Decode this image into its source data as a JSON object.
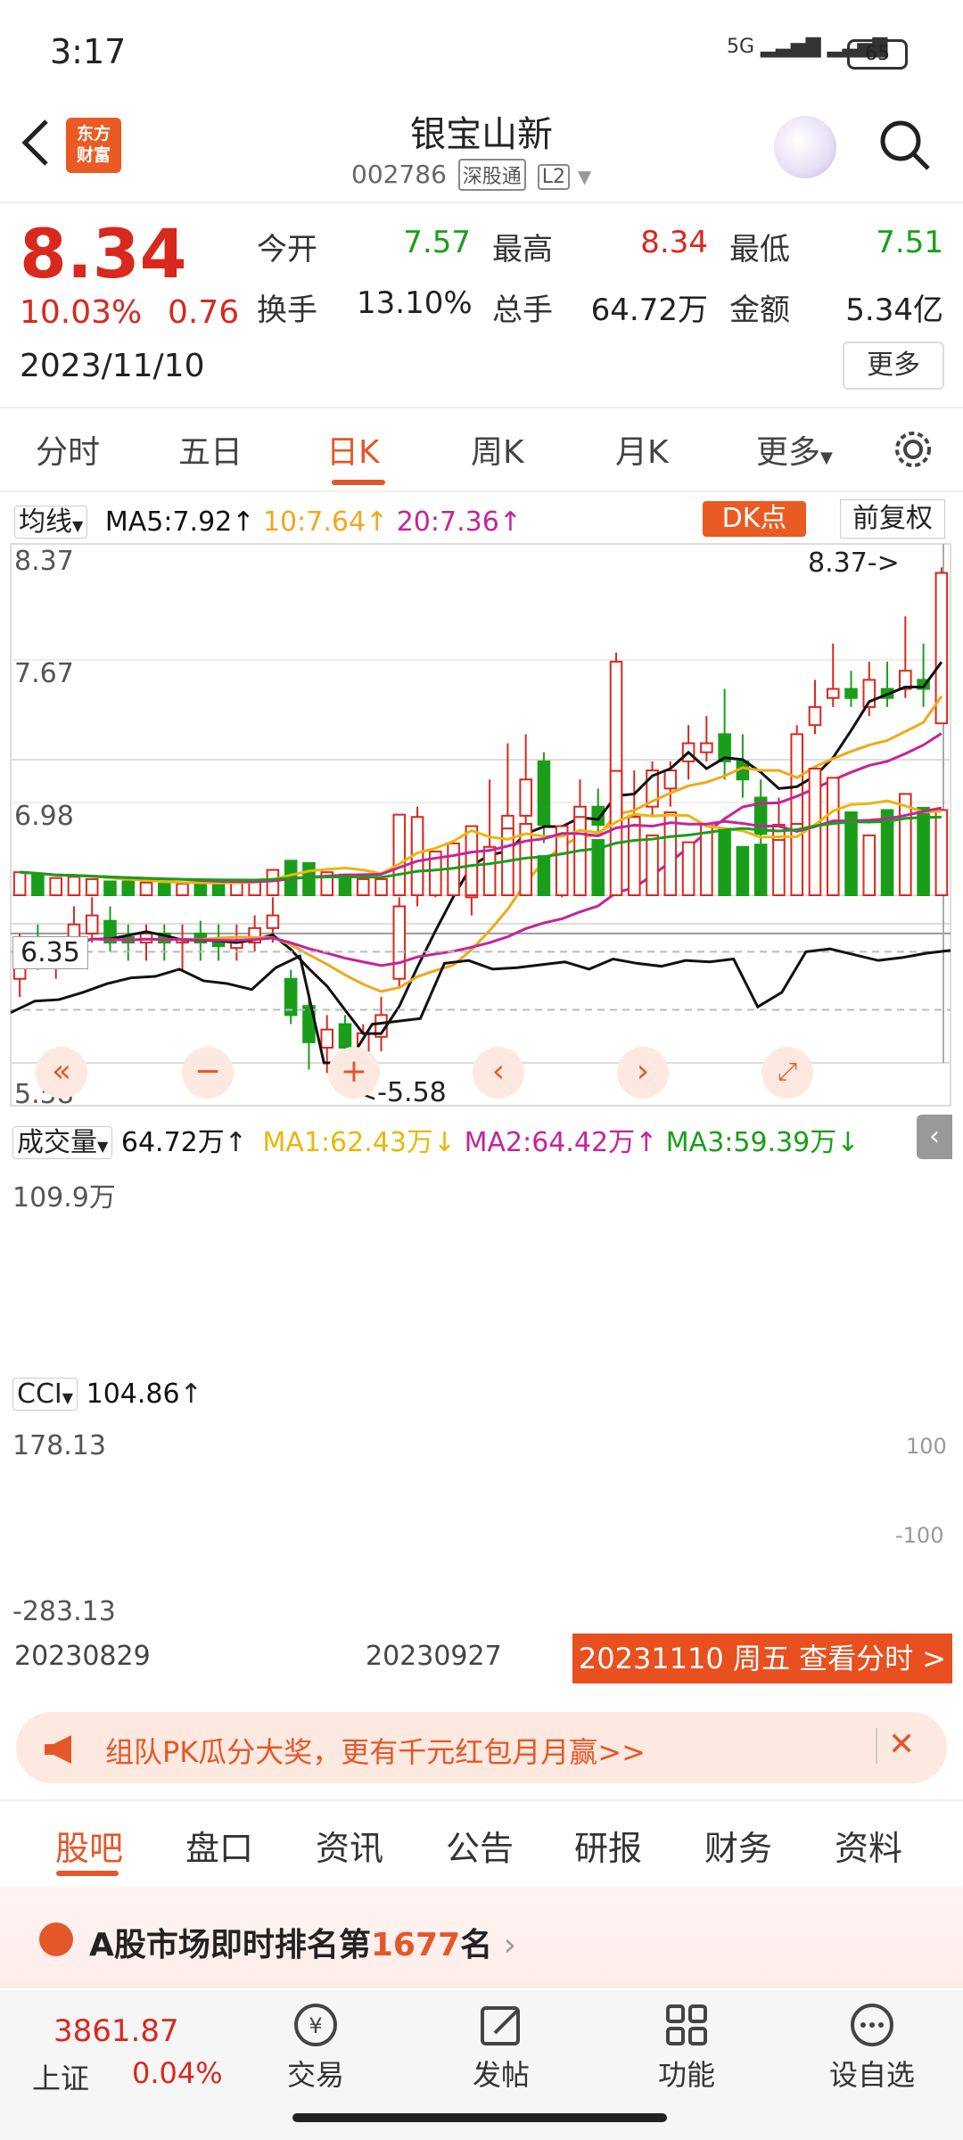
{
  "status_bar": {
    "time": "3:17",
    "signal": "5G",
    "battery": "65"
  },
  "header": {
    "logo_line1": "东方",
    "logo_line2": "财富",
    "stock_name": "银宝山新",
    "stock_code": "002786",
    "tag1": "深股通",
    "tag2": "L2"
  },
  "quote": {
    "price": "8.34",
    "change_pct": "10.03%",
    "change": "0.76",
    "date": "2023/11/10",
    "open_label": "今开",
    "open": "7.57",
    "high_label": "最高",
    "high": "8.34",
    "low_label": "最低",
    "low": "7.51",
    "turnover_label": "换手",
    "turnover": "13.10%",
    "volume_label": "总手",
    "volume": "64.72万",
    "amount_label": "金额",
    "amount": "5.34亿",
    "more": "更多"
  },
  "tabs": [
    "分时",
    "五日",
    "日K",
    "周K",
    "月K",
    "更多"
  ],
  "ma_bar": {
    "selector": "均线",
    "ma5": "MA5:7.92",
    "ma10": "10:7.64",
    "ma20": "20:7.36",
    "dk": "DK点",
    "fq": "前复权"
  },
  "price_axis": [
    "8.37",
    "7.67",
    "6.98",
    "6.35",
    "5.58"
  ],
  "annotations": {
    "high_marker": "8.37->",
    "low_marker": "<-5.58"
  },
  "volume_bar": {
    "selector": "成交量",
    "value": "64.72万",
    "ma1": "MA1:62.43万",
    "ma2": "MA2:64.42万",
    "ma3": "MA3:59.39万",
    "axis_max": "109.9万"
  },
  "cci_bar": {
    "selector": "CCI",
    "value": "104.86",
    "axis_top": "178.13",
    "axis_bottom": "-283.13",
    "level_top": "100",
    "level_bottom": "-100"
  },
  "date_axis": {
    "d1": "20230829",
    "d2": "20230927",
    "current": "20231110 周五 查看分时 >"
  },
  "banner": {
    "text": "组队PK瓜分大奖，更有千元红包月月赢>>"
  },
  "bottom_tabs": [
    "股吧",
    "盘口",
    "资讯",
    "公告",
    "研报",
    "财务",
    "资料"
  ],
  "rank": {
    "prefix": "A股市场即时排名第",
    "number": "1677",
    "suffix": "名"
  },
  "bottom_nav": {
    "index_value": "3861.87",
    "index_name": "上证",
    "index_pct": "0.04%",
    "items": [
      "交易",
      "发帖",
      "功能",
      "设自选"
    ]
  },
  "colors": {
    "up": "#d9281e",
    "down": "#1a9e1a",
    "accent": "#e4572a",
    "ma5": "#111111",
    "ma10": "#f0a81b",
    "ma20": "#c4249a"
  },
  "chart_data": {
    "type": "candlestick",
    "ylim": [
      5.4,
      8.5
    ],
    "candles": [
      [
        6.1,
        6.3,
        6.35,
        6.0
      ],
      [
        6.28,
        6.2,
        6.4,
        6.15
      ],
      [
        6.2,
        6.25,
        6.3,
        6.1
      ],
      [
        6.25,
        6.4,
        6.5,
        6.2
      ],
      [
        6.35,
        6.45,
        6.55,
        6.3
      ],
      [
        6.42,
        6.3,
        6.5,
        6.25
      ],
      [
        6.33,
        6.3,
        6.4,
        6.2
      ],
      [
        6.3,
        6.35,
        6.4,
        6.2
      ],
      [
        6.35,
        6.3,
        6.4,
        6.2
      ],
      [
        6.3,
        6.32,
        6.4,
        6.15
      ],
      [
        6.35,
        6.3,
        6.42,
        6.2
      ],
      [
        6.3,
        6.28,
        6.4,
        6.2
      ],
      [
        6.27,
        6.3,
        6.4,
        6.2
      ],
      [
        6.3,
        6.38,
        6.45,
        6.25
      ],
      [
        6.38,
        6.45,
        6.55,
        6.3
      ],
      [
        6.1,
        5.9,
        6.15,
        5.85
      ],
      [
        5.95,
        5.75,
        6.0,
        5.6
      ],
      [
        5.72,
        5.82,
        5.9,
        5.58
      ],
      [
        5.85,
        5.72,
        5.9,
        5.65
      ],
      [
        5.7,
        5.8,
        5.85,
        5.62
      ],
      [
        5.78,
        5.9,
        6.0,
        5.7
      ],
      [
        6.1,
        6.5,
        6.55,
        6.05
      ],
      [
        6.6,
        6.9,
        7.05,
        6.5
      ],
      [
        6.65,
        6.72,
        6.8,
        6.55
      ],
      [
        6.7,
        6.75,
        6.8,
        6.6
      ],
      [
        6.55,
        6.75,
        6.85,
        6.45
      ],
      [
        6.7,
        6.8,
        7.2,
        6.6
      ],
      [
        6.8,
        7.0,
        7.4,
        6.7
      ],
      [
        7.0,
        7.2,
        7.45,
        6.9
      ],
      [
        7.3,
        6.95,
        7.35,
        6.85
      ],
      [
        6.65,
        6.75,
        6.95,
        6.55
      ],
      [
        6.9,
        7.05,
        7.2,
        6.85
      ],
      [
        7.05,
        6.95,
        7.15,
        6.9
      ],
      [
        6.95,
        7.85,
        7.9,
        6.9
      ],
      [
        6.9,
        7.0,
        7.25,
        6.85
      ],
      [
        7.05,
        7.25,
        7.3,
        7.0
      ],
      [
        7.15,
        7.25,
        7.3,
        7.05
      ],
      [
        7.3,
        7.4,
        7.5,
        7.2
      ],
      [
        7.35,
        7.4,
        7.55,
        7.3
      ],
      [
        7.45,
        7.3,
        7.7,
        7.2
      ],
      [
        7.3,
        7.2,
        7.45,
        7.1
      ],
      [
        7.1,
        6.9,
        7.2,
        6.75
      ],
      [
        6.85,
        6.95,
        7.1,
        6.8
      ],
      [
        6.85,
        7.45,
        7.5,
        6.8
      ],
      [
        7.5,
        7.6,
        7.75,
        7.45
      ],
      [
        7.65,
        7.7,
        7.95,
        7.6
      ],
      [
        7.7,
        7.65,
        7.8,
        7.6
      ],
      [
        7.6,
        7.75,
        7.85,
        7.55
      ],
      [
        7.7,
        7.65,
        7.85,
        7.6
      ],
      [
        7.7,
        7.8,
        8.1,
        7.65
      ],
      [
        7.75,
        7.7,
        7.95,
        7.6
      ],
      [
        7.51,
        8.34,
        8.37,
        7.51
      ]
    ],
    "volume": [
      20,
      18,
      15,
      16,
      14,
      12,
      12,
      11,
      10,
      10,
      11,
      11,
      12,
      13,
      22,
      30,
      28,
      20,
      18,
      14,
      14,
      70,
      68,
      38,
      45,
      60,
      42,
      58,
      62,
      34,
      60,
      68,
      48,
      108,
      68,
      52,
      72,
      46,
      62,
      58,
      42,
      44,
      48,
      62,
      110,
      102,
      72,
      52,
      74,
      88,
      76,
      74
    ],
    "cci": [
      -110,
      -70,
      -65,
      -40,
      -10,
      10,
      15,
      40,
      0,
      -10,
      -30,
      45,
      85,
      -320,
      -300,
      -150,
      -140,
      -130,
      60,
      70,
      40,
      45,
      55,
      65,
      40,
      75,
      60,
      50,
      70,
      65,
      75,
      -90,
      -40,
      100,
      110,
      90,
      70,
      80,
      95,
      104.86
    ]
  }
}
